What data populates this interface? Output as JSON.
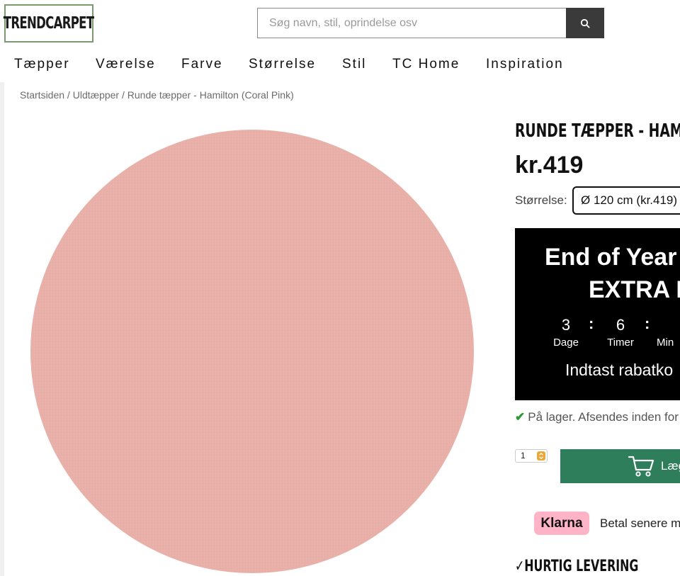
{
  "header": {
    "logo_text": "TRENDCARPET",
    "search": {
      "placeholder": "Søg navn, stil, oprindelse osv",
      "value": ""
    }
  },
  "nav": {
    "items": [
      {
        "label": "Tæpper"
      },
      {
        "label": "Værelse"
      },
      {
        "label": "Farve"
      },
      {
        "label": "Størrelse"
      },
      {
        "label": "Stil"
      },
      {
        "label": "TC Home"
      },
      {
        "label": "Inspiration"
      }
    ]
  },
  "breadcrumb": {
    "items": [
      "Startsiden",
      "Uldtæpper",
      "Runde tæpper - Hamilton (Coral Pink)"
    ],
    "separator": " / "
  },
  "product": {
    "title": "RUNDE TÆPPER - HAMILTON (CORAL PINK)",
    "price": "kr.419",
    "size_label": "Størrelse:",
    "size_selected": "Ø 120 cm (kr.419)",
    "image_color": "#e8b0a8"
  },
  "promo": {
    "headline_1": "End of Year",
    "headline_2": "EXTRA R",
    "countdown": [
      {
        "value": "3",
        "label": "Dage"
      },
      {
        "value": "6",
        "label": "Timer"
      },
      {
        "value": "",
        "label": "Min"
      }
    ],
    "separator": ":",
    "code_text": "Indtast rabatko"
  },
  "stock": {
    "text": "På lager. Afsendes inden for"
  },
  "quantity": {
    "value": "1"
  },
  "cart": {
    "label": "Læg"
  },
  "klarna": {
    "badge": "Klarna",
    "text": "Betal senere m"
  },
  "delivery": {
    "text": "HURTIG LEVERING"
  },
  "colors": {
    "brand_green": "#2e7d5b",
    "logo_border": "#7b9a6f",
    "klarna_pink": "#ffb3c7",
    "stock_check": "#2e9a2e"
  }
}
